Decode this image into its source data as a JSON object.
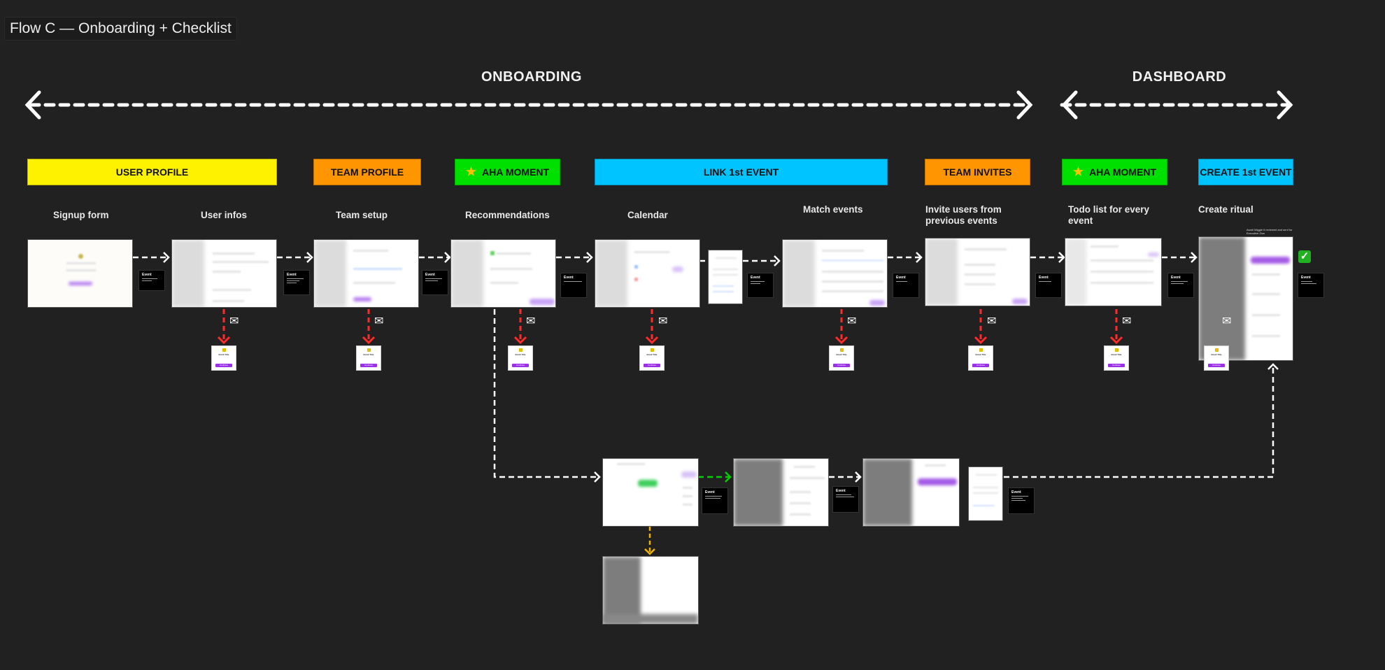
{
  "title": "Flow C — Onboarding + Checklist",
  "zones": [
    {
      "label": "ONBOARDING"
    },
    {
      "label": "DASHBOARD"
    }
  ],
  "bands": [
    {
      "label": "USER PROFILE",
      "color": "#fff200",
      "star": false
    },
    {
      "label": "TEAM PROFILE",
      "color": "#ff9500",
      "star": false
    },
    {
      "label": "AHA MOMENT",
      "color": "#00e000",
      "star": true
    },
    {
      "label": "LINK 1st EVENT",
      "color": "#00c4ff",
      "star": false
    },
    {
      "label": "TEAM INVITES",
      "color": "#ff9500",
      "star": false
    },
    {
      "label": "AHA MOMENT",
      "color": "#00e000",
      "star": true
    },
    {
      "label": "CREATE 1st EVENT",
      "color": "#00c4ff",
      "star": false
    }
  ],
  "steps": [
    {
      "label": "Signup form"
    },
    {
      "label": "User infos"
    },
    {
      "label": "Team setup"
    },
    {
      "label": "Recommendations"
    },
    {
      "label": "Calendar"
    },
    {
      "label": "Match events"
    },
    {
      "label": "Invite users from previous events"
    },
    {
      "label": "Todo list for every event"
    },
    {
      "label": "Create ritual"
    }
  ],
  "event_note": {
    "title": "Event"
  },
  "email_card": {
    "title": "Email Title",
    "button": "Continue"
  },
  "icons": {
    "star": "★",
    "envelope": "✉",
    "check": "✓"
  },
  "create_ritual_caption": "Await Wiggle it reviewed and sent for Executive Zion",
  "arrow_colors": {
    "flow": "#ffffff",
    "email": "#ff2a2a",
    "success": "#00d000",
    "alt": "#f0b400"
  }
}
